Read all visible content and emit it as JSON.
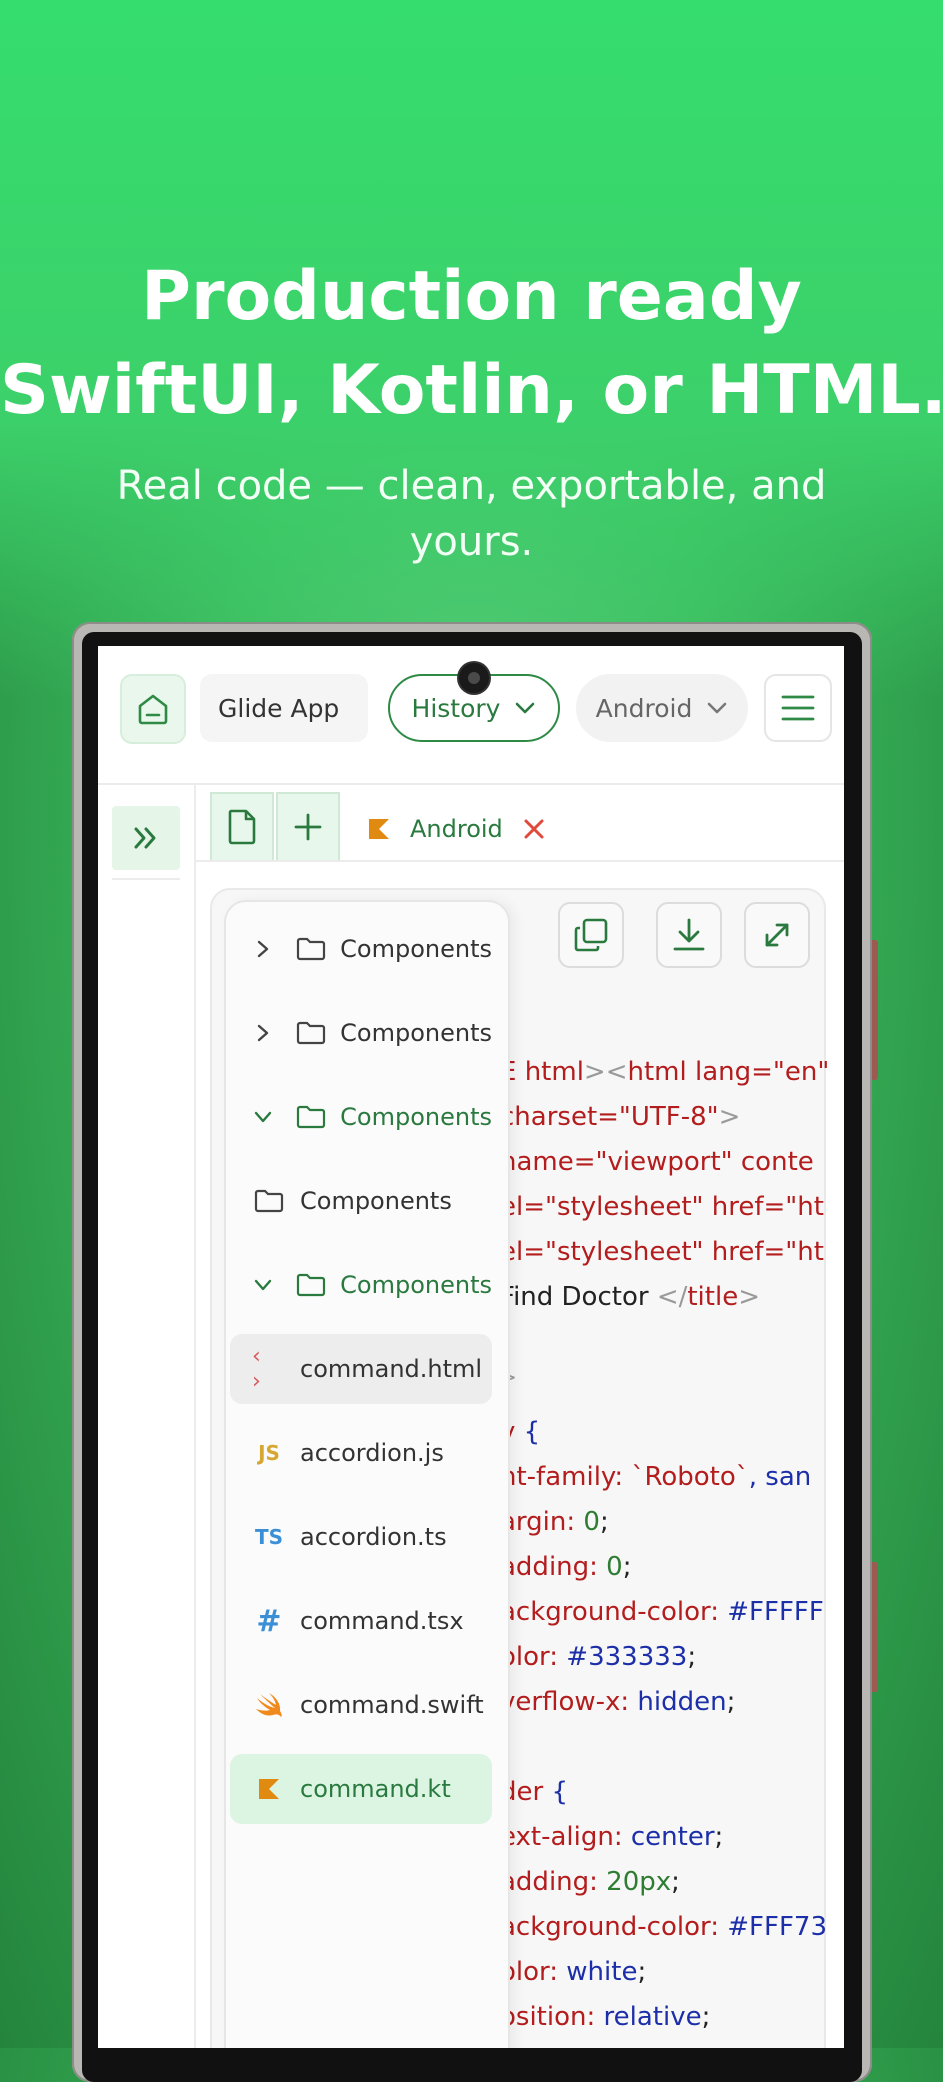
{
  "hero": {
    "title_line1": "Production ready",
    "title_line2": "SwiftUI, Kotlin, or HTML.",
    "subtitle": "Real code — clean, exportable, and yours."
  },
  "topbar": {
    "app_name": "Glide App",
    "history_label": "History",
    "platform_label": "Android"
  },
  "tabs": {
    "active_tab": "Android"
  },
  "file_tree": [
    {
      "label": "Components",
      "icon": "folder-icon",
      "state": "collapsed"
    },
    {
      "label": "Components",
      "icon": "folder-icon",
      "state": "collapsed"
    },
    {
      "label": "Components",
      "icon": "folder-icon",
      "state": "expanded"
    },
    {
      "label": "Components",
      "icon": "folder-icon",
      "state": "none"
    },
    {
      "label": "Components",
      "icon": "folder-icon",
      "state": "expanded"
    },
    {
      "label": "command.html",
      "icon": "html-code-icon",
      "badge": "‹ ›"
    },
    {
      "label": "accordion.js",
      "icon": "js-icon",
      "badge": "JS"
    },
    {
      "label": "accordion.ts",
      "icon": "ts-icon",
      "badge": "TS"
    },
    {
      "label": "command.tsx",
      "icon": "hash-icon",
      "badge": "#"
    },
    {
      "label": "command.swift",
      "icon": "swift-icon"
    },
    {
      "label": "command.kt",
      "icon": "kotlin-icon"
    }
  ],
  "code": {
    "l1_a": "E html",
    "l1_b": "><",
    "l1_c": "html lang=",
    "l1_d": "\"en\"",
    "l2_a": "charset=",
    "l2_b": "\"UTF-8\"",
    "l2_c": ">",
    "l3_a": "name=",
    "l3_b": "\"viewport\"",
    "l3_c": "  conte",
    "l4_a": "el=",
    "l4_b": "\"stylesheet\"",
    "l4_c": "  href=",
    "l4_d": "\"ht",
    "l5_a": "el=",
    "l5_b": "\"stylesheet\"",
    "l5_c": "  href=",
    "l5_d": "\"ht",
    "l6_a": " Find Doctor ",
    "l6_b": "</",
    "l6_c": "title",
    "l6_d": ">",
    "l7": ">",
    "l8_a": "y",
    "l8_b": "  {",
    "l9_a": "nt-family: ",
    "l9_b": "`Roboto`",
    "l9_c": ", san",
    "l10_a": "argin: ",
    "l10_b": "0",
    "l10_c": ";",
    "l11_a": "adding: ",
    "l11_b": "0",
    "l11_c": ";",
    "l12_a": "ackground-color: ",
    "l12_b": "#FFFFF",
    "l13_a": "olor: ",
    "l13_b": "#333333",
    "l13_c": ";",
    "l14_a": "verflow-x: ",
    "l14_b": "hidden",
    "l14_c": ";",
    "l15_a": "der",
    "l15_b": "  {",
    "l16_a": "ext-align: ",
    "l16_b": "center",
    "l16_c": ";",
    "l17_a": "adding: ",
    "l17_b": "20px",
    "l17_c": ";",
    "l18_a": "ackground-color: ",
    "l18_b": "#FFF73",
    "l19_a": "olor: ",
    "l19_b": "white",
    "l19_c": ";",
    "l20_a": "osition: ",
    "l20_b": "relative",
    "l20_c": ";"
  },
  "colors": {
    "brand_green": "#2a7a3f",
    "hero_bg": "#35dd6e",
    "selected_green_bg": "#dcf5e3"
  }
}
